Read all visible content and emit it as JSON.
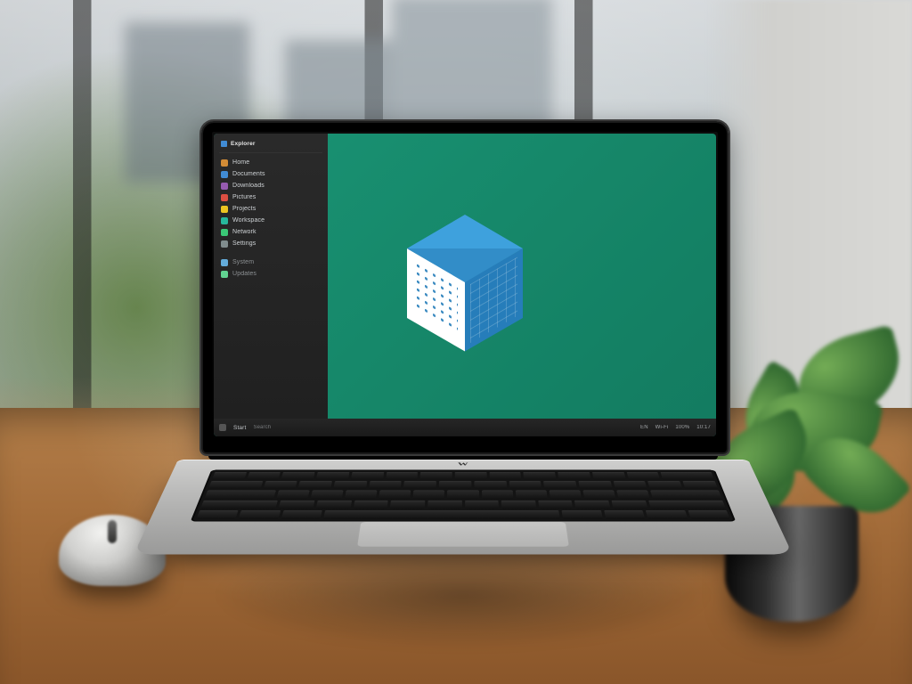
{
  "scene": {
    "laptop_brand": "W"
  },
  "screen": {
    "desktop_color": "#0c8a69",
    "logo_name": "cube-logo"
  },
  "sidebar": {
    "title": "Explorer",
    "items": [
      {
        "label": "Home",
        "icon_color": "#d98b2b"
      },
      {
        "label": "Documents",
        "icon_color": "#3a8dde"
      },
      {
        "label": "Downloads",
        "icon_color": "#9b59b6"
      },
      {
        "label": "Pictures",
        "icon_color": "#e84c3d"
      },
      {
        "label": "Projects",
        "icon_color": "#f1c40f"
      },
      {
        "label": "Workspace",
        "icon_color": "#1abc9c"
      },
      {
        "label": "Network",
        "icon_color": "#2ecc71"
      },
      {
        "label": "Settings",
        "icon_color": "#7f8c8d"
      }
    ],
    "footer_items": [
      {
        "label": "System",
        "icon_color": "#5dade2"
      },
      {
        "label": "Updates",
        "icon_color": "#58d68d"
      }
    ]
  },
  "taskbar": {
    "start_label": "Start",
    "search_placeholder": "Search",
    "tray": [
      "EN",
      "Wi-Fi",
      "100%"
    ],
    "clock": "10:17"
  }
}
